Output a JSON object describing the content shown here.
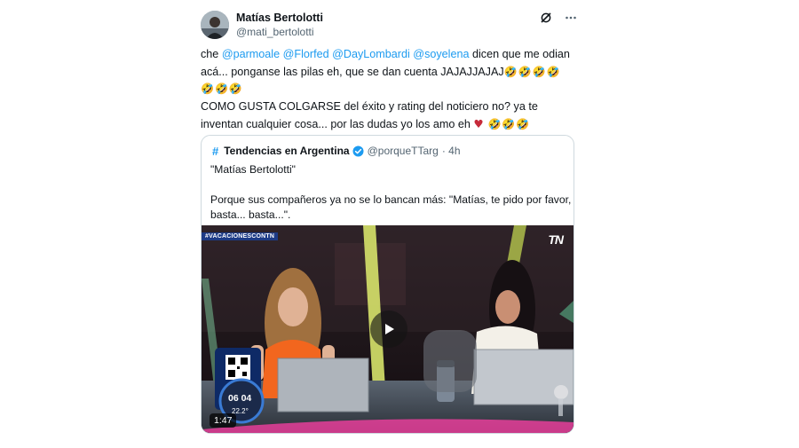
{
  "author": {
    "name": "Matías Bertolotti",
    "handle": "@mati_bertolotti"
  },
  "icons": {
    "grok": "grok-icon",
    "more": "more-icon",
    "verified": "verified-badge-icon",
    "play": "play-icon"
  },
  "tweet": {
    "line1": {
      "prefix": "che ",
      "mentions": [
        "@parmoale",
        "@Florfed",
        "@DayLombardi",
        "@soyelena"
      ],
      "suffix": " dicen que me odian"
    },
    "line2_text": "acá... ponganse las pilas eh, que se dan cuenta JAJAJJAJAJ",
    "line2_emojis": "🤣🤣🤣🤣",
    "line3_emojis": "🤣🤣🤣",
    "line4": "COMO GUSTA COLGARSE del éxito y rating del noticiero no? ya te",
    "line5_text": "inventan cualquier cosa... por las dudas yo los amo eh ",
    "line5_heart": "♥",
    "line5_emojis": " 🤣🤣🤣"
  },
  "quote": {
    "hashtag_symbol": "#",
    "account_name": "Tendencias en Argentina",
    "account_handle": "@porqueTTarg",
    "time": "· 4h",
    "title_line": "\"Matías Bertolotti\"",
    "body_line1": "Porque sus compañeros ya no se lo bancan más: \"Matías, te pido por favor,",
    "body_line2": "basta... basta...\".",
    "video": {
      "duration": "1:47",
      "tag": "#VACACIONESCONTN",
      "channel_logo": "TN",
      "clock_time": "06 04",
      "temperature": "22.2°"
    }
  },
  "colors": {
    "mention": "#1d9bf0",
    "text": "#0f1419",
    "secondary": "#536471",
    "border": "#cfd9de",
    "heart": "#c62a3a"
  }
}
